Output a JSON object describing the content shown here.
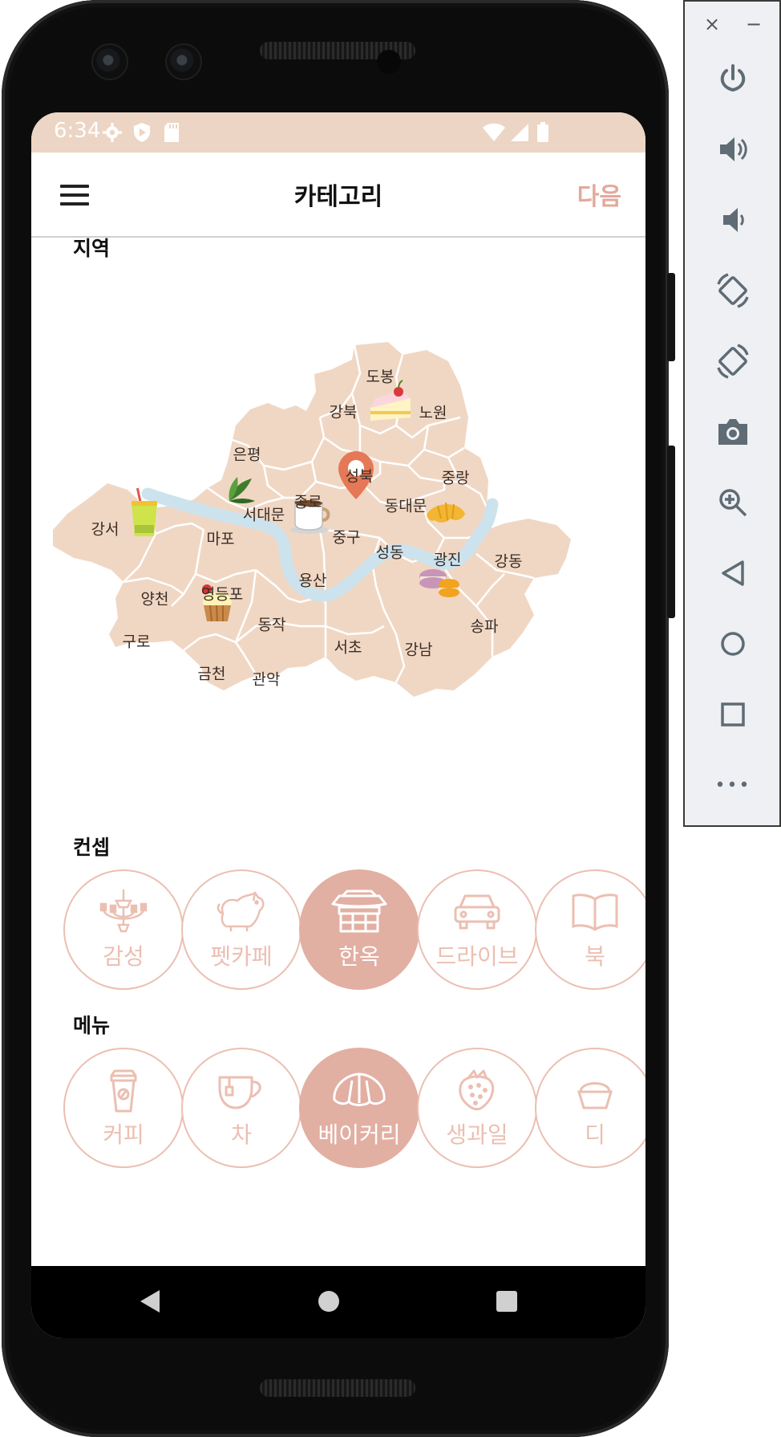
{
  "status_bar": {
    "time": "6:34"
  },
  "header": {
    "title": "카테고리",
    "next_label": "다음"
  },
  "sections": {
    "region": "지역",
    "concept": "컨셉",
    "menu": "메뉴"
  },
  "map": {
    "districts": {
      "dobong": "도봉",
      "gangbuk": "강북",
      "nowon": "노원",
      "eunpyeong": "은평",
      "seongbuk": "성북",
      "jungnang": "중랑",
      "jongno": "종로",
      "dongdaemun": "동대문",
      "seodaemun": "서대문",
      "gangseo": "강서",
      "mapo": "마포",
      "junggu": "중구",
      "seongdong": "성동",
      "gwangjin": "광진",
      "gangdong": "강동",
      "yongsan": "용산",
      "yangcheon": "양천",
      "yeongdeungpo": "영등포",
      "dongjak": "동작",
      "songpa": "송파",
      "guro": "구로",
      "seocho": "서초",
      "gangnam": "강남",
      "geumcheon": "금천",
      "gwanak": "관악"
    },
    "fill_color": "#f0d7c4",
    "river_color": "#cce3ee",
    "pin_color": "#e57857"
  },
  "concepts": [
    {
      "label": "감성",
      "icon": "chandelier-icon",
      "selected": false
    },
    {
      "label": "펫카페",
      "icon": "dog-icon",
      "selected": false
    },
    {
      "label": "한옥",
      "icon": "hanok-icon",
      "selected": true
    },
    {
      "label": "드라이브",
      "icon": "car-icon",
      "selected": false
    },
    {
      "label": "북",
      "icon": "book-icon",
      "selected": false
    }
  ],
  "menus": [
    {
      "label": "커피",
      "icon": "coffee-cup-icon",
      "selected": false
    },
    {
      "label": "차",
      "icon": "tea-cup-icon",
      "selected": false
    },
    {
      "label": "베이커리",
      "icon": "croissant-icon",
      "selected": true
    },
    {
      "label": "생과일",
      "icon": "strawberry-icon",
      "selected": false
    },
    {
      "label": "디",
      "icon": "dessert-icon",
      "selected": false
    }
  ],
  "theme": {
    "accent": "#e3a99b",
    "chip_border": "#ebbfb2",
    "chip_selected": "#e2afa3",
    "status_bar": "#ecd5c4"
  },
  "emulator": {
    "close": "×",
    "minimize": "−",
    "more": "•••"
  }
}
